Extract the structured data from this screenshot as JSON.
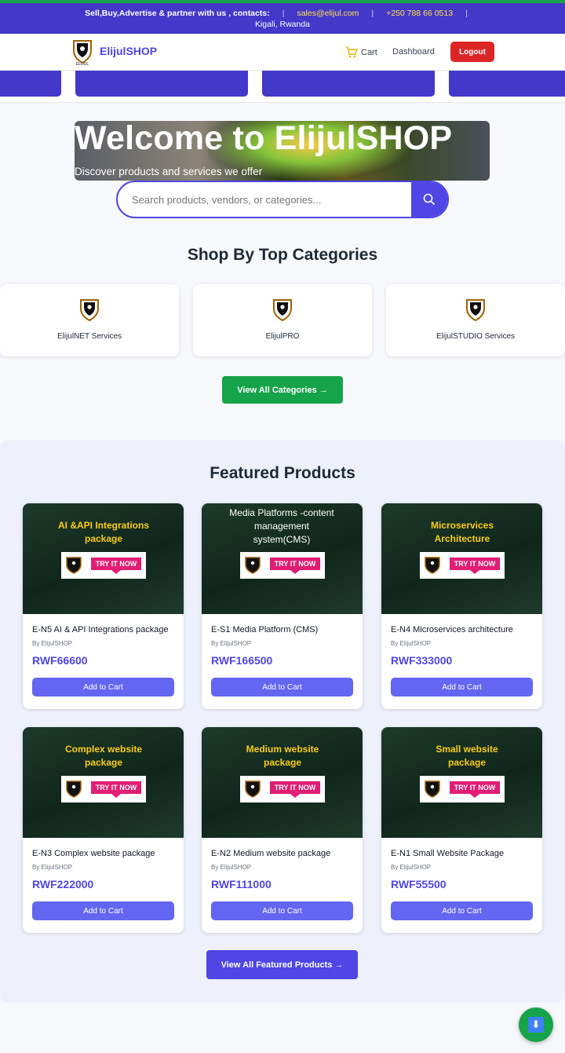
{
  "topbar": {
    "contact_text": "Sell,Buy,Advertise & partner with us , contacts:",
    "email": "sales@elijul.com",
    "phone": "+250 788 66 0513",
    "location": "Kigali, Rwanda"
  },
  "header": {
    "brand": "ElijulSHOP",
    "cart_label": "Cart",
    "dashboard_label": "Dashboard",
    "logout_label": "Logout"
  },
  "hero": {
    "title": "Welcome to ElijulSHOP",
    "subtitle": "Discover products and services we offer"
  },
  "search": {
    "placeholder": "Search products, vendors, or categories..."
  },
  "categories": {
    "heading": "Shop By Top Categories",
    "items": [
      {
        "name": "ElijulNET Services"
      },
      {
        "name": "ElijulPRO"
      },
      {
        "name": "ElijulSTUDIO Services"
      }
    ],
    "view_all": "View All Categories →"
  },
  "featured": {
    "heading": "Featured Products",
    "badge_text": "TRY IT NOW",
    "products": [
      {
        "image_title": "AI &API Integrations package",
        "name": "E-N5 AI & API Integrations package",
        "vendor": "By ElijulSHOP",
        "price": "RWF66600",
        "add": "Add to Cart"
      },
      {
        "image_title": "Media Platforms -content management system(CMS)",
        "name": "E-S1 Media Platform (CMS)",
        "vendor": "By ElijulSHOP",
        "price": "RWF166500",
        "add": "Add to Cart"
      },
      {
        "image_title": "Microservices Architecture",
        "name": "E-N4 Microservices architecture",
        "vendor": "By ElijulSHOP",
        "price": "RWF333000",
        "add": "Add to Cart"
      },
      {
        "image_title": "Complex website package",
        "name": "E-N3 Complex website package",
        "vendor": "By ElijulSHOP",
        "price": "RWF222000",
        "add": "Add to Cart"
      },
      {
        "image_title": "Medium website package",
        "name": "E-N2 Medium website package",
        "vendor": "By ElijulSHOP",
        "price": "RWF111000",
        "add": "Add to Cart"
      },
      {
        "image_title": "Small website package",
        "name": "E-N1 Small Website Package",
        "vendor": "By ElijulSHOP",
        "price": "RWF55500",
        "add": "Add to Cart"
      }
    ],
    "view_all": "View All Featured Products →"
  },
  "fab": {
    "icon": "down-arrow-icon",
    "glyph": "⬇"
  },
  "colors": {
    "primary": "#4f46e5",
    "green": "#16a34a",
    "logout": "#dc2626",
    "badge": "#e11d74"
  }
}
